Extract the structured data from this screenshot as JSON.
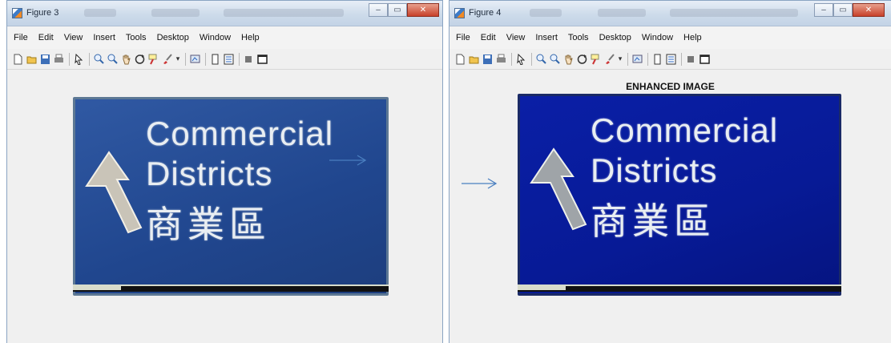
{
  "windows": [
    {
      "title": "Figure 3",
      "menu": [
        "File",
        "Edit",
        "View",
        "Insert",
        "Tools",
        "Desktop",
        "Window",
        "Help"
      ],
      "axes_title": "",
      "sign": {
        "line1": "Commercial",
        "line2": "Districts",
        "line3": "商業區"
      },
      "accent": "#20468e"
    },
    {
      "title": "Figure 4",
      "menu": [
        "File",
        "Edit",
        "View",
        "Insert",
        "Tools",
        "Desktop",
        "Window",
        "Help"
      ],
      "axes_title": "ENHANCED IMAGE",
      "sign": {
        "line1": "Commercial",
        "line2": "Districts",
        "line3": "商業區"
      },
      "accent": "#071a96"
    }
  ],
  "toolbar_icons": [
    "new-file-icon",
    "open-file-icon",
    "save-icon",
    "print-icon",
    "pointer-icon",
    "zoom-in-icon",
    "zoom-out-icon",
    "pan-icon",
    "rotate-icon",
    "data-cursor-icon",
    "brush-icon",
    "link-plot-icon",
    "colorbar-icon",
    "legend-icon",
    "hide-plot-tools-icon",
    "show-plot-tools-icon"
  ],
  "arrow_color": "#4a7fc0"
}
